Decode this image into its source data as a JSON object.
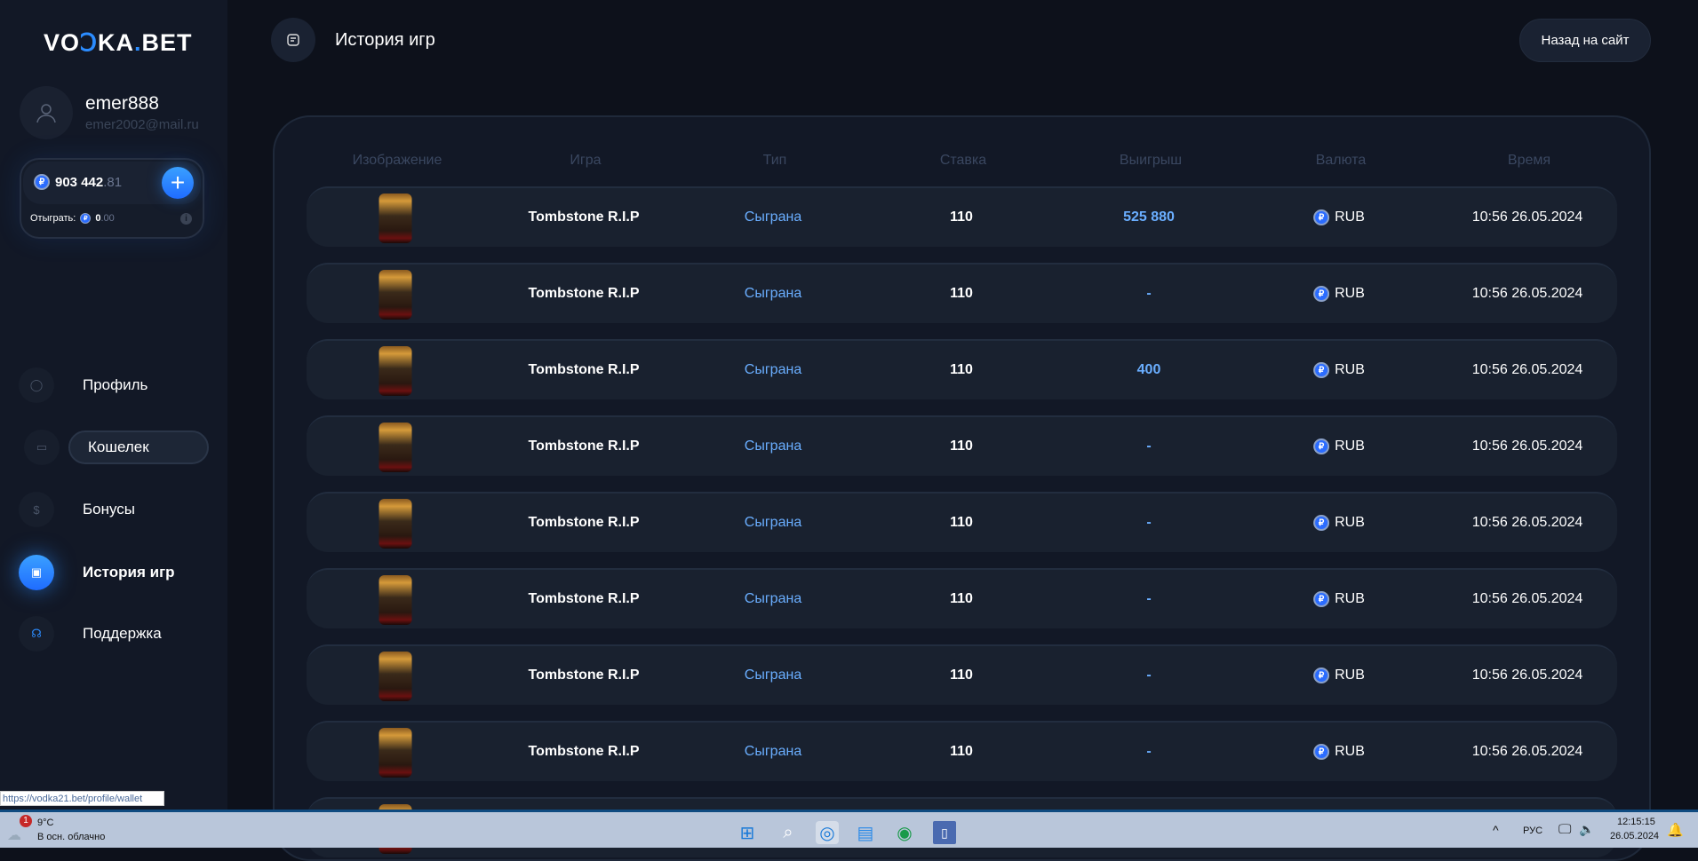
{
  "logo": {
    "left": "VO",
    "mid": "Ↄ",
    "right": "KA",
    "dot": ".",
    "end": "BET"
  },
  "user": {
    "name": "emer888",
    "email": "emer2002@mail.ru"
  },
  "balance": {
    "coin": "₽",
    "whole": "903 442",
    "decimal": ".81",
    "wager_label": "Отыграть:",
    "wager_whole": "0",
    "wager_decimal": ".00",
    "info": "i",
    "plus": "+"
  },
  "nav": [
    {
      "label": "Профиль",
      "icon": "user-icon"
    },
    {
      "label": "Кошелек",
      "icon": "card-icon"
    },
    {
      "label": "Бонусы",
      "icon": "money-bag-icon"
    },
    {
      "label": "История игр",
      "icon": "history-icon"
    },
    {
      "label": "Поддержка",
      "icon": "headset-icon"
    }
  ],
  "header": {
    "title": "История игр",
    "back_label": "Назад на сайт"
  },
  "table": {
    "columns": [
      "Изображение",
      "Игра",
      "Тип",
      "Ставка",
      "Выигрыш",
      "Валюта",
      "Время"
    ],
    "rows": [
      {
        "game": "Tombstone R.I.P",
        "type": "Сыграна",
        "bet": "110",
        "win": "525 880",
        "currency": "RUB",
        "time": "10:56 26.05.2024"
      },
      {
        "game": "Tombstone R.I.P",
        "type": "Сыграна",
        "bet": "110",
        "win": "-",
        "currency": "RUB",
        "time": "10:56 26.05.2024"
      },
      {
        "game": "Tombstone R.I.P",
        "type": "Сыграна",
        "bet": "110",
        "win": "400",
        "currency": "RUB",
        "time": "10:56 26.05.2024"
      },
      {
        "game": "Tombstone R.I.P",
        "type": "Сыграна",
        "bet": "110",
        "win": "-",
        "currency": "RUB",
        "time": "10:56 26.05.2024"
      },
      {
        "game": "Tombstone R.I.P",
        "type": "Сыграна",
        "bet": "110",
        "win": "-",
        "currency": "RUB",
        "time": "10:56 26.05.2024"
      },
      {
        "game": "Tombstone R.I.P",
        "type": "Сыграна",
        "bet": "110",
        "win": "-",
        "currency": "RUB",
        "time": "10:56 26.05.2024"
      },
      {
        "game": "Tombstone R.I.P",
        "type": "Сыграна",
        "bet": "110",
        "win": "-",
        "currency": "RUB",
        "time": "10:56 26.05.2024"
      },
      {
        "game": "Tombstone R.I.P",
        "type": "Сыграна",
        "bet": "110",
        "win": "-",
        "currency": "RUB",
        "time": "10:56 26.05.2024"
      }
    ]
  },
  "status_url": "https://vodka21.bet/profile/wallet",
  "taskbar": {
    "weather_temp": "9°C",
    "weather_desc": "В осн. облачно",
    "badge": "1",
    "lang": "РУС",
    "time": "12:15:15",
    "date": "26.05.2024"
  },
  "colors": {
    "accent": "#2b8cff",
    "win": "#6aaeff"
  }
}
